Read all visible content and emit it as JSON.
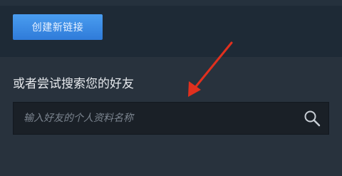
{
  "top": {
    "create_link_label": "创建新链接"
  },
  "search": {
    "heading": "或者尝试搜索您的好友",
    "placeholder": "输入好友的个人资料名称",
    "value": ""
  },
  "icons": {
    "search": "search-icon",
    "annotation": "red-arrow-icon"
  },
  "colors": {
    "accent_button": "#3b8de6",
    "annotation_arrow": "#e0301e",
    "panel_background": "#28323d",
    "input_background": "#1a2027"
  }
}
